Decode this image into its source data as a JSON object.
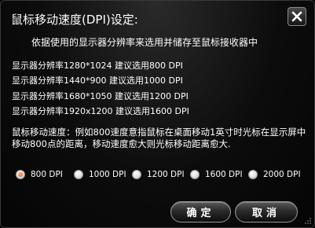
{
  "dialog": {
    "title": "鼠标移动速度(DPI)设定:",
    "subtitle": "依据使用的显示器分辨率来选用并储存至鼠标接收器中",
    "resolutions": [
      "显示器分辨率1280*1024 建议选用800  DPI",
      "显示器分辨率1440*900  建议选用1000 DPI",
      "显示器分辨率1680*1050 建议选用1200 DPI",
      "显示器分辨率1920x1200 建议选用1600 DPI"
    ],
    "description": "鼠标移动速度：例如800速度意指鼠标在桌面移动1英寸时光标在显示屏中移动800点的距离，移动速度愈大则光标移动距离愈大.",
    "dpi_options": [
      {
        "label": "800  DPI",
        "checked": true
      },
      {
        "label": "1000 DPI",
        "checked": false
      },
      {
        "label": "1200 DPI",
        "checked": false
      },
      {
        "label": "1600 DPI",
        "checked": false
      },
      {
        "label": "2000 DPI",
        "checked": false
      }
    ],
    "ok_label": "确定",
    "cancel_label": "取消"
  },
  "colors": {
    "background": "#0c0c0c",
    "text": "#ffffff",
    "radio_selected": "#e06010"
  }
}
